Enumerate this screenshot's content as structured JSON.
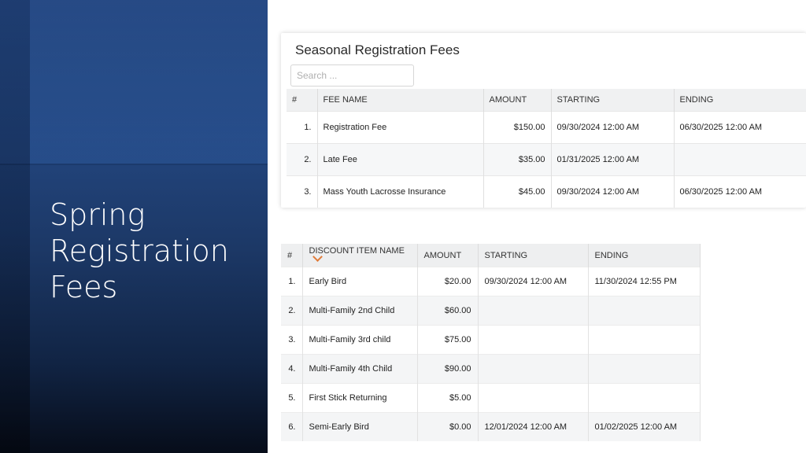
{
  "slide": {
    "title_lines": [
      "Spring",
      "Registration",
      "Fees"
    ]
  },
  "fees": {
    "title": "Seasonal Registration Fees",
    "search_placeholder": "Search ...",
    "headers": [
      "#",
      "FEE NAME",
      "AMOUNT",
      "STARTING",
      "ENDING"
    ],
    "rows": [
      {
        "num": "1.",
        "name": "Registration Fee",
        "amount": "$150.00",
        "starting": "09/30/2024 12:00 AM",
        "ending": "06/30/2025 12:00 AM"
      },
      {
        "num": "2.",
        "name": "Late Fee",
        "amount": "$35.00",
        "starting": "01/31/2025 12:00 AM",
        "ending": ""
      },
      {
        "num": "3.",
        "name": "Mass Youth Lacrosse Insurance",
        "amount": "$45.00",
        "starting": "09/30/2024 12:00 AM",
        "ending": "06/30/2025 12:00 AM"
      }
    ]
  },
  "discounts": {
    "headers": [
      "#",
      "DISCOUNT ITEM NAME",
      "AMOUNT",
      "STARTING",
      "ENDING"
    ],
    "sort_icon": "chevron-down-icon",
    "sort_color": "#e07b39",
    "rows": [
      {
        "num": "1.",
        "name": "Early Bird",
        "amount": "$20.00",
        "starting": "09/30/2024 12:00 AM",
        "ending": "11/30/2024 12:55 PM"
      },
      {
        "num": "2.",
        "name": "Multi-Family 2nd Child",
        "amount": "$60.00",
        "starting": "",
        "ending": ""
      },
      {
        "num": "3.",
        "name": "Multi-Family 3rd child",
        "amount": "$75.00",
        "starting": "",
        "ending": ""
      },
      {
        "num": "4.",
        "name": "Multi-Family 4th Child",
        "amount": "$90.00",
        "starting": "",
        "ending": ""
      },
      {
        "num": "5.",
        "name": "First Stick Returning",
        "amount": "$5.00",
        "starting": "",
        "ending": ""
      },
      {
        "num": "6.",
        "name": "Semi-Early Bird",
        "amount": "$0.00",
        "starting": "12/01/2024 12:00 AM",
        "ending": "01/02/2025 12:00 AM"
      }
    ]
  },
  "colors": {
    "panel_blue": "#23467f",
    "header_gray": "#f0f1f2",
    "accent_orange": "#e07b39"
  }
}
